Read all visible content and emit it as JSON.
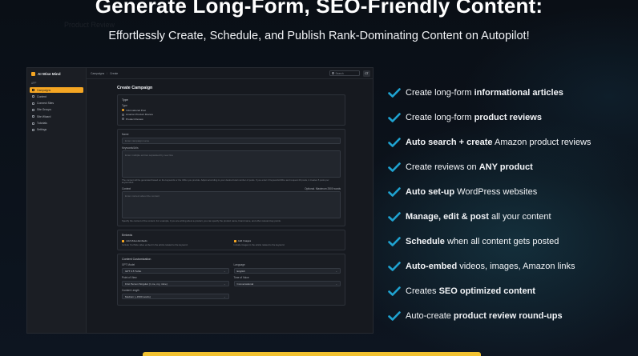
{
  "headline": "Generate Long-Form, SEO-Friendly Content:",
  "subheadline": "Effortlessly Create, Schedule, and Publish Rank-Dominating Content on Autopilot!",
  "ghost_text": "Product Review",
  "app": {
    "brand": "AI Wise Mind",
    "sidebar_section": "APP",
    "sidebar_items": [
      "Campaigns",
      "Content",
      "Connect Sites",
      "Site Groups",
      "Site Wizard",
      "Tutorials",
      "Settings"
    ],
    "breadcrumb": [
      "Campaigns",
      "Create"
    ],
    "search_placeholder": "Search",
    "avatar_initials": "CT",
    "page_title": "Create Campaign",
    "type_card": {
      "title": "Type",
      "label": "Type",
      "options": [
        "Informational Post",
        "Amazon Product Review",
        "Product Review"
      ],
      "selected": "Informational Post"
    },
    "name_card": {
      "name_label": "Name",
      "name_placeholder": "Enter campaign name",
      "keywords_label": "Keywords/Urls",
      "keywords_placeholder": "Enter multiple entries separated by new line",
      "keywords_help": "The content will be generated based on the keywords or the URLs you provide. Adjust according to your desired total number of posts. If you enter 4 Keywords/URLs and request 20 posts, it creates 5 posts per keyword/url.",
      "context_label": "Context",
      "context_optional": "Optional. Maximum 2500 words",
      "context_placeholder": "Enter context about the content",
      "context_help": "Specify the context of the content. For example, if you are writing about a product, you can specify the product name, brand name, and other relevant key points."
    },
    "embeds_card": {
      "title": "Embeds",
      "video_label": "Add Video Embeds",
      "video_help": "Include YouTube video embed in the article related to the keyword.",
      "images_label": "Add Images",
      "images_help": "Include images in the article related to the keyword."
    },
    "custom_card": {
      "title": "Content Customization",
      "gpt_label": "GPT Model",
      "gpt_value": "GPT 3.5 Turbo",
      "language_label": "Language",
      "language_value": "English",
      "pov_label": "Point of View",
      "pov_value": "First Person Singular (I, me, my, mine)",
      "tone_label": "Tone of Voice",
      "tone_value": "Conversational",
      "length_label": "Content Length",
      "length_value": "Medium (~1500 words)"
    }
  },
  "features": [
    {
      "pre": "Create long-form ",
      "bold": "informational articles",
      "post": ""
    },
    {
      "pre": "Create long-form ",
      "bold": "product reviews",
      "post": ""
    },
    {
      "pre": "",
      "bold": "Auto search + create",
      "post": " Amazon product reviews"
    },
    {
      "pre": "Create reviews on ",
      "bold": "ANY product",
      "post": ""
    },
    {
      "pre": "",
      "bold": "Auto set-up",
      "post": " WordPress websites"
    },
    {
      "pre": "",
      "bold": "Manage, edit & post",
      "post": " all your content"
    },
    {
      "pre": "",
      "bold": "Schedule",
      "post": " when all content gets posted"
    },
    {
      "pre": "",
      "bold": "Auto-embed",
      "post": " videos, images, Amazon links"
    },
    {
      "pre": "Creates ",
      "bold": "SEO optimized content",
      "post": ""
    },
    {
      "pre": "Auto-create ",
      "bold": "product review round-ups",
      "post": ""
    }
  ],
  "colors": {
    "accent": "#f5a623",
    "check": "#1fa3d1",
    "cta": "#f2c230"
  }
}
